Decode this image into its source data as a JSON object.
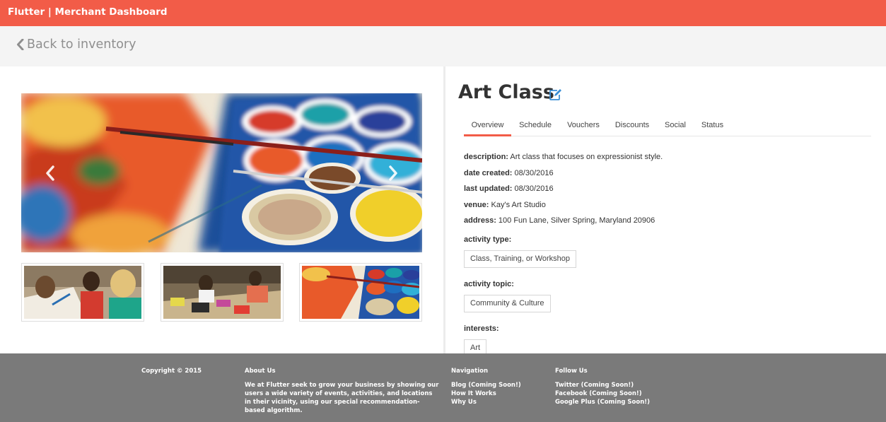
{
  "header": {
    "brand": "Flutter | Merchant Dashboard"
  },
  "nav": {
    "back_label": "Back to inventory"
  },
  "activity": {
    "title": "Art Class",
    "tabs": [
      {
        "label": "Overview",
        "active": true
      },
      {
        "label": "Schedule",
        "active": false
      },
      {
        "label": "Vouchers",
        "active": false
      },
      {
        "label": "Discounts",
        "active": false
      },
      {
        "label": "Social",
        "active": false
      },
      {
        "label": "Status",
        "active": false
      }
    ],
    "fields": {
      "description": {
        "label": "description:",
        "value": "Art class that focuses on expressionist style."
      },
      "date_created": {
        "label": "date created:",
        "value": "08/30/2016"
      },
      "last_updated": {
        "label": "last updated:",
        "value": "08/30/2016"
      },
      "venue": {
        "label": "venue:",
        "value": "Kay's Art Studio"
      },
      "address": {
        "label": "address:",
        "value": "100 Fun Lane, Silver Spring, Maryland 20906"
      }
    },
    "activity_type": {
      "label": "activity type:",
      "value": "Class, Training, or Workshop"
    },
    "activity_topic": {
      "label": "activity topic:",
      "value": "Community & Culture"
    },
    "interests": {
      "label": "interests:",
      "value": "Art"
    }
  },
  "footer": {
    "copyright": "Copyright © 2015",
    "about": {
      "heading": "About Us",
      "text": "We at Flutter seek to grow your business by showing our users a wide variety of events, activities, and locations in their vicinity, using our special recommendation-based algorithm."
    },
    "navigation": {
      "heading": "Navigation",
      "links": [
        "Blog (Coming Soon!)",
        "How It Works",
        "Why Us"
      ]
    },
    "follow": {
      "heading": "Follow Us",
      "links": [
        "Twitter (Coming Soon!)",
        "Facebook (Coming Soon!)",
        "Google Plus (Coming Soon!)"
      ]
    }
  },
  "colors": {
    "accent": "#f25c48",
    "footer_bg": "#7a7a7a",
    "edit_icon": "#3a8fd6"
  },
  "icons": {
    "back": "chevron-left-icon",
    "edit": "edit-icon",
    "prev": "chevron-left-icon",
    "next": "chevron-right-icon"
  }
}
